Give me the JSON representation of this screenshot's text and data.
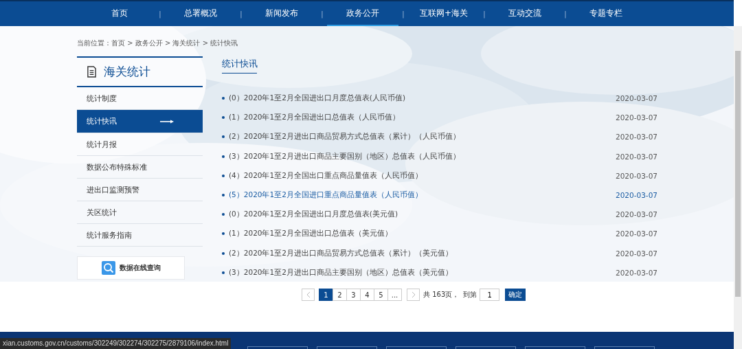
{
  "nav": {
    "items": [
      {
        "label": "首页",
        "selected": false
      },
      {
        "label": "总署概况",
        "selected": false
      },
      {
        "label": "新闻发布",
        "selected": false
      },
      {
        "label": "政务公开",
        "selected": true
      },
      {
        "label": "互联网+海关",
        "selected": false
      },
      {
        "label": "互动交流",
        "selected": false
      },
      {
        "label": "专题专栏",
        "selected": false
      }
    ],
    "separator": "|"
  },
  "breadcrumb": "当前位置：首页 > 政务公开 > 海关统计 > 统计快讯",
  "sidebar": {
    "title": "海关统计",
    "items": [
      {
        "label": "统计制度",
        "selected": false
      },
      {
        "label": "统计快讯",
        "selected": true
      },
      {
        "label": "统计月报",
        "selected": false
      },
      {
        "label": "数据公布特殊标准",
        "selected": false
      },
      {
        "label": "进出口监测预警",
        "selected": false
      },
      {
        "label": "关区统计",
        "selected": false
      },
      {
        "label": "统计服务指南",
        "selected": false
      }
    ],
    "query_button": "数据在线查询"
  },
  "section_title": "统计快讯",
  "articles": [
    {
      "title": "(0）2020年1至2月全国进出口月度总值表(人民币值)",
      "date": "2020-03-07",
      "hovered": false
    },
    {
      "title": "(1）2020年1至2月全国进出口总值表（人民币值）",
      "date": "2020-03-07",
      "hovered": false
    },
    {
      "title": "(2）2020年1至2月进出口商品贸易方式总值表（累计）（人民币值）",
      "date": "2020-03-07",
      "hovered": false
    },
    {
      "title": "(3）2020年1至2月进出口商品主要国别（地区）总值表（人民币值）",
      "date": "2020-03-07",
      "hovered": false
    },
    {
      "title": "(4）2020年1至2月全国出口重点商品量值表（人民币值）",
      "date": "2020-03-07",
      "hovered": false
    },
    {
      "title": "(5）2020年1至2月全国进口重点商品量值表（人民币值）",
      "date": "2020-03-07",
      "hovered": true
    },
    {
      "title": "(0）2020年1至2月全国进出口月度总值表(美元值)",
      "date": "2020-03-07",
      "hovered": false
    },
    {
      "title": "(1）2020年1至2月全国进出口总值表（美元值）",
      "date": "2020-03-07",
      "hovered": false
    },
    {
      "title": "(2）2020年1至2月进出口商品贸易方式总值表（累计）（美元值）",
      "date": "2020-03-07",
      "hovered": false
    },
    {
      "title": "(3）2020年1至2月进出口商品主要国别（地区）总值表（美元值）",
      "date": "2020-03-07",
      "hovered": false
    }
  ],
  "pagination": {
    "pages": [
      {
        "label": "1",
        "selected": true
      },
      {
        "label": "2",
        "selected": false
      },
      {
        "label": "3",
        "selected": false
      },
      {
        "label": "4",
        "selected": false
      },
      {
        "label": "5",
        "selected": false
      },
      {
        "label": "...",
        "selected": false
      }
    ],
    "total": "共 163页，",
    "goto_label": "到第",
    "goto_value": "1",
    "confirm": "确定"
  },
  "status_url": "xian.customs.gov.cn/customs/302249/302274/302275/2879106/index.html"
}
